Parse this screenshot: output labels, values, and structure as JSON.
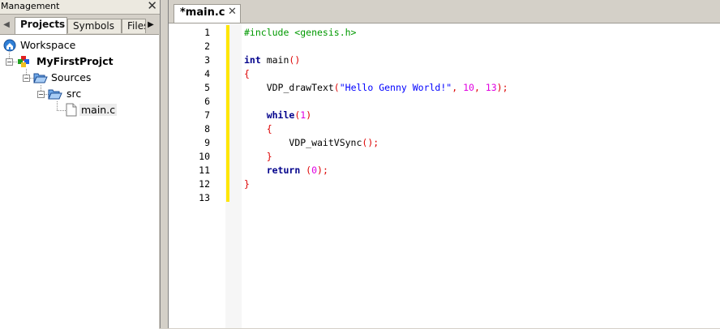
{
  "management": {
    "title": "Management",
    "close_glyph": "✕",
    "scroll_left_glyph": "◀",
    "scroll_right_glyph": "▶",
    "tabs": {
      "projects": "Projects",
      "symbols": "Symbols",
      "files": "Files"
    },
    "tree": {
      "workspace": "Workspace",
      "project": "MyFirstProjct",
      "sources": "Sources",
      "src": "src",
      "file": "main.c"
    }
  },
  "editor": {
    "tab_label": "*main.c",
    "tab_close_glyph": "✕",
    "line_numbers": [
      "1",
      "2",
      "3",
      "4",
      "5",
      "6",
      "7",
      "8",
      "9",
      "10",
      "11",
      "12",
      "13"
    ],
    "code": {
      "l1": {
        "pp": "#include <genesis.h>"
      },
      "l3": {
        "kw": "int",
        "id": " main",
        "op": "()"
      },
      "l4": {
        "op": "{"
      },
      "l5": {
        "indent": "    ",
        "id": "VDP_drawText",
        "op1": "(",
        "str": "\"Hello Genny World!\"",
        "op2": ", ",
        "num1": "10",
        "op3": ", ",
        "num2": "13",
        "op4": ");"
      },
      "l7": {
        "indent": "    ",
        "kw": "while",
        "op1": "(",
        "num": "1",
        "op2": ")"
      },
      "l8": {
        "indent": "    ",
        "op": "{"
      },
      "l9": {
        "indent": "        ",
        "id": "VDP_waitVSync",
        "op": "();"
      },
      "l10": {
        "indent": "    ",
        "op": "}"
      },
      "l11": {
        "indent": "    ",
        "kw": "return",
        "op1": " (",
        "num": "0",
        "op2": ");"
      },
      "l12": {
        "op": "}"
      }
    }
  },
  "colors": {
    "preprocessor": "#009900",
    "keyword": "#00008b",
    "operator": "#dd0000",
    "string": "#0000ff",
    "number": "#e000e0",
    "changed_line_marker": "#ffe600"
  },
  "icons": {
    "workspace": "workspace-globe-icon",
    "project": "project-icon",
    "folder": "open-folder-icon",
    "file": "c-file-icon"
  }
}
